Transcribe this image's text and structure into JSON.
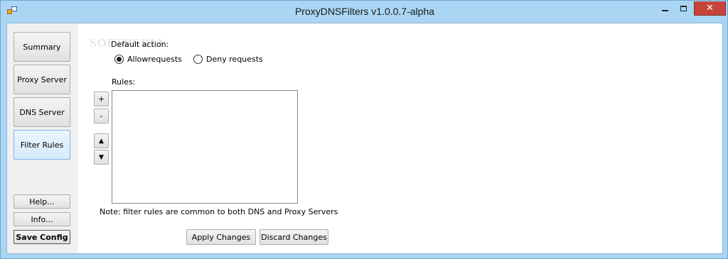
{
  "window": {
    "title": "ProxyDNSFilters v1.0.0.7-alpha",
    "close_glyph": "✕"
  },
  "sidebar": {
    "items": [
      {
        "label": "Summary"
      },
      {
        "label": "Proxy Server"
      },
      {
        "label": "DNS Server"
      },
      {
        "label": "Filter Rules",
        "active": true
      }
    ],
    "help_label": "Help...",
    "info_label": "Info...",
    "save_label": "Save Config"
  },
  "main": {
    "watermark": "SOFTPEDIA",
    "default_action_label": "Default action:",
    "allow_label": "Allowrequests",
    "deny_label": "Deny requests",
    "selected_action": "allow",
    "rules_label": "Rules:",
    "add_label": "+",
    "remove_label": "-",
    "up_label": "▲",
    "down_label": "▼",
    "note": "Note: filter rules are common to both DNS and Proxy Servers",
    "apply_label": "Apply Changes",
    "discard_label": "Discard Changes"
  },
  "icons": [
    "app-icon",
    "minimize-icon",
    "maximize-icon",
    "close-icon"
  ],
  "colors": {
    "frame": "#aad6f3",
    "close_button": "#c7443b",
    "active_nav": "#d6ebfa"
  }
}
